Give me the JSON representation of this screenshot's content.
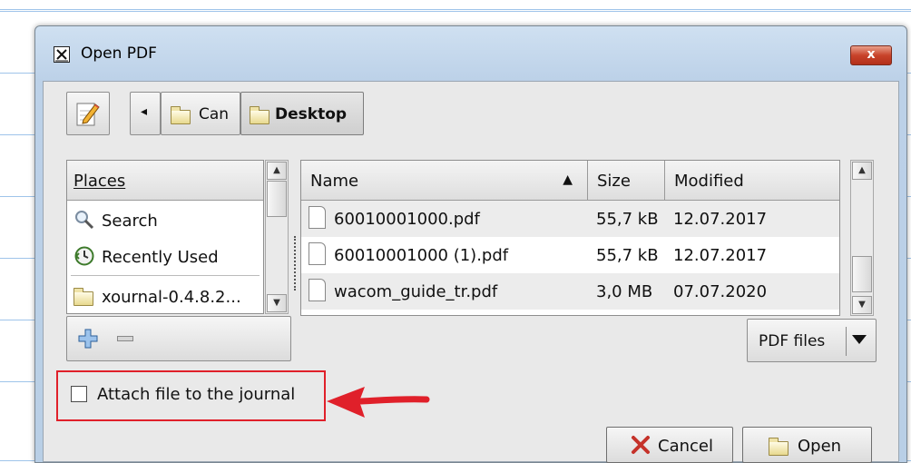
{
  "dialog": {
    "title": "Open PDF",
    "close_glyph": "x"
  },
  "toolbar": {
    "edit_icon": "edit-location-icon",
    "back_glyph": "◂",
    "breadcrumb": [
      {
        "label": "Can",
        "icon": "folder-icon"
      },
      {
        "label": "Desktop",
        "icon": "folder-icon"
      }
    ]
  },
  "places": {
    "header": "Places",
    "items": [
      {
        "label": "Search",
        "icon": "search-icon"
      },
      {
        "label": "Recently Used",
        "icon": "recent-icon"
      },
      {
        "label": "xournal-0.4.8.2...",
        "icon": "folder-icon"
      }
    ],
    "add_glyph": "add-bookmark-icon",
    "remove_glyph": "remove-bookmark-icon"
  },
  "files": {
    "columns": [
      "Name",
      "Size",
      "Modified"
    ],
    "sort_glyph": "▲",
    "rows": [
      {
        "name": "60010001000.pdf",
        "size": "55,7 kB",
        "modified": "12.07.2017"
      },
      {
        "name": "60010001000 (1).pdf",
        "size": "55,7 kB",
        "modified": "12.07.2017"
      },
      {
        "name": "wacom_guide_tr.pdf",
        "size": "3,0 MB",
        "modified": "07.07.2020"
      }
    ]
  },
  "filter": {
    "selected": "PDF files"
  },
  "attach": {
    "label": "Attach file to the journal",
    "checked": false
  },
  "buttons": {
    "cancel": "Cancel",
    "open": "Open"
  },
  "colors": {
    "annotation": "#e0202a",
    "close_button": "#c8432a",
    "ruling": "#9fc4ea"
  }
}
